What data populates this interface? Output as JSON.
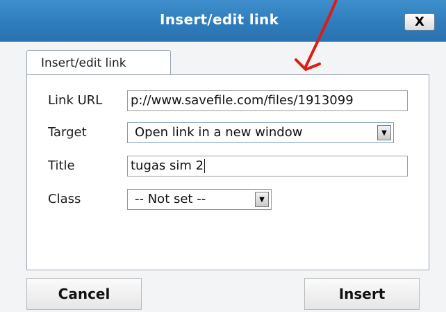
{
  "dialog": {
    "title": "Insert/edit link",
    "close_label": "X"
  },
  "tabs": [
    {
      "label": "Insert/edit link"
    }
  ],
  "form": {
    "link_url": {
      "label": "Link URL",
      "value": "p://www.savefile.com/files/1913099"
    },
    "target": {
      "label": "Target",
      "selected": "Open link in a new window"
    },
    "title": {
      "label": "Title",
      "value": "tugas sim 2"
    },
    "class": {
      "label": "Class",
      "selected": "-- Not set --"
    }
  },
  "buttons": {
    "cancel": "Cancel",
    "insert": "Insert"
  },
  "colors": {
    "titlebar": "#2f7cbc",
    "annotation_arrow": "#e01b12"
  }
}
